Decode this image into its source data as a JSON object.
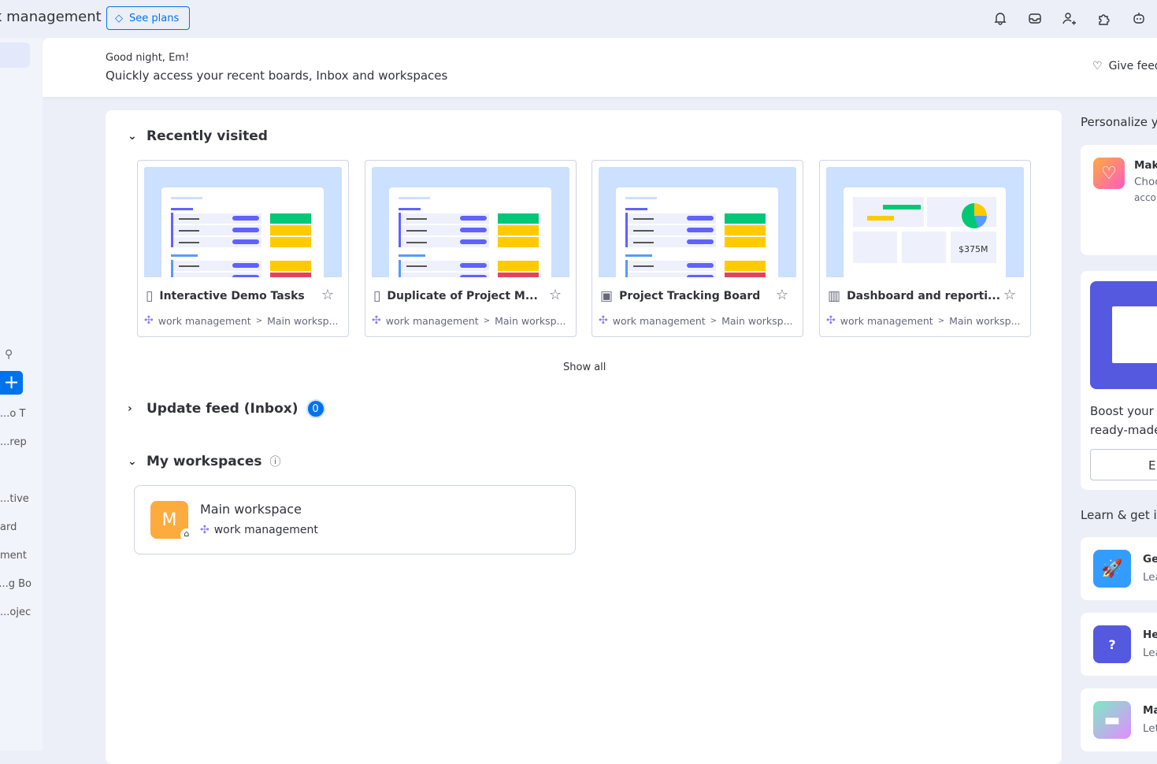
{
  "topbar": {
    "app_title": "k management",
    "see_plans": "See plans",
    "icons": [
      "bell-icon",
      "inbox-icon",
      "invite-user-icon",
      "apps-puzzle-icon",
      "ai-robot-icon"
    ]
  },
  "sidebar": {
    "items": [
      "o T...",
      "rep...",
      "tive...",
      "ard",
      "ment",
      "g Bo...",
      "ojec..."
    ]
  },
  "header": {
    "greeting": "Good night, Em!",
    "subtitle": "Quickly access your recent boards, Inbox and workspaces",
    "feedback": "Give feedback"
  },
  "recent": {
    "title": "Recently visited",
    "show_all": "Show all",
    "boards": [
      {
        "name": "Interactive Demo Tasks",
        "icon": "board-icon",
        "crumb_ws": "work management",
        "crumb_sep": ">",
        "crumb_sub": "Main worksp..."
      },
      {
        "name": "Duplicate of Project M...",
        "icon": "board-icon",
        "crumb_ws": "work management",
        "crumb_sep": ">",
        "crumb_sub": "Main worksp..."
      },
      {
        "name": "Project Tracking Board",
        "icon": "board-share-icon",
        "crumb_ws": "work management",
        "crumb_sep": ">",
        "crumb_sub": "Main worksp..."
      },
      {
        "name": "Dashboard and reporti...",
        "icon": "dashboard-icon",
        "crumb_ws": "work management",
        "crumb_sep": ">",
        "crumb_sub": "Main worksp...",
        "thumb_value": "$375M"
      }
    ]
  },
  "inbox": {
    "title": "Update feed (Inbox)",
    "count": "0"
  },
  "workspaces": {
    "title": "My workspaces",
    "items": [
      {
        "initial": "M",
        "name": "Main workspace",
        "product": "work management"
      }
    ]
  },
  "right": {
    "personalize_title": "Personalize yo",
    "make_title": "Mak",
    "make_sub1": "Choo",
    "make_sub2": "acco",
    "boost1": "Boost your v",
    "boost2": "ready-made",
    "explore": "E:",
    "learn_title": "Learn & get in",
    "learn": [
      {
        "t": "Ge",
        "s": "Lea",
        "color": "#339dff"
      },
      {
        "t": "He",
        "s": "Lea",
        "color": "#5559df"
      },
      {
        "t": "Ma",
        "s": "Let",
        "color": "#a18dff"
      }
    ]
  },
  "colors": {
    "accent": "#0073ea",
    "done": "#00c875",
    "working": "#ffcb00",
    "stuck": "#e2445c",
    "bg": "#eceff8"
  }
}
